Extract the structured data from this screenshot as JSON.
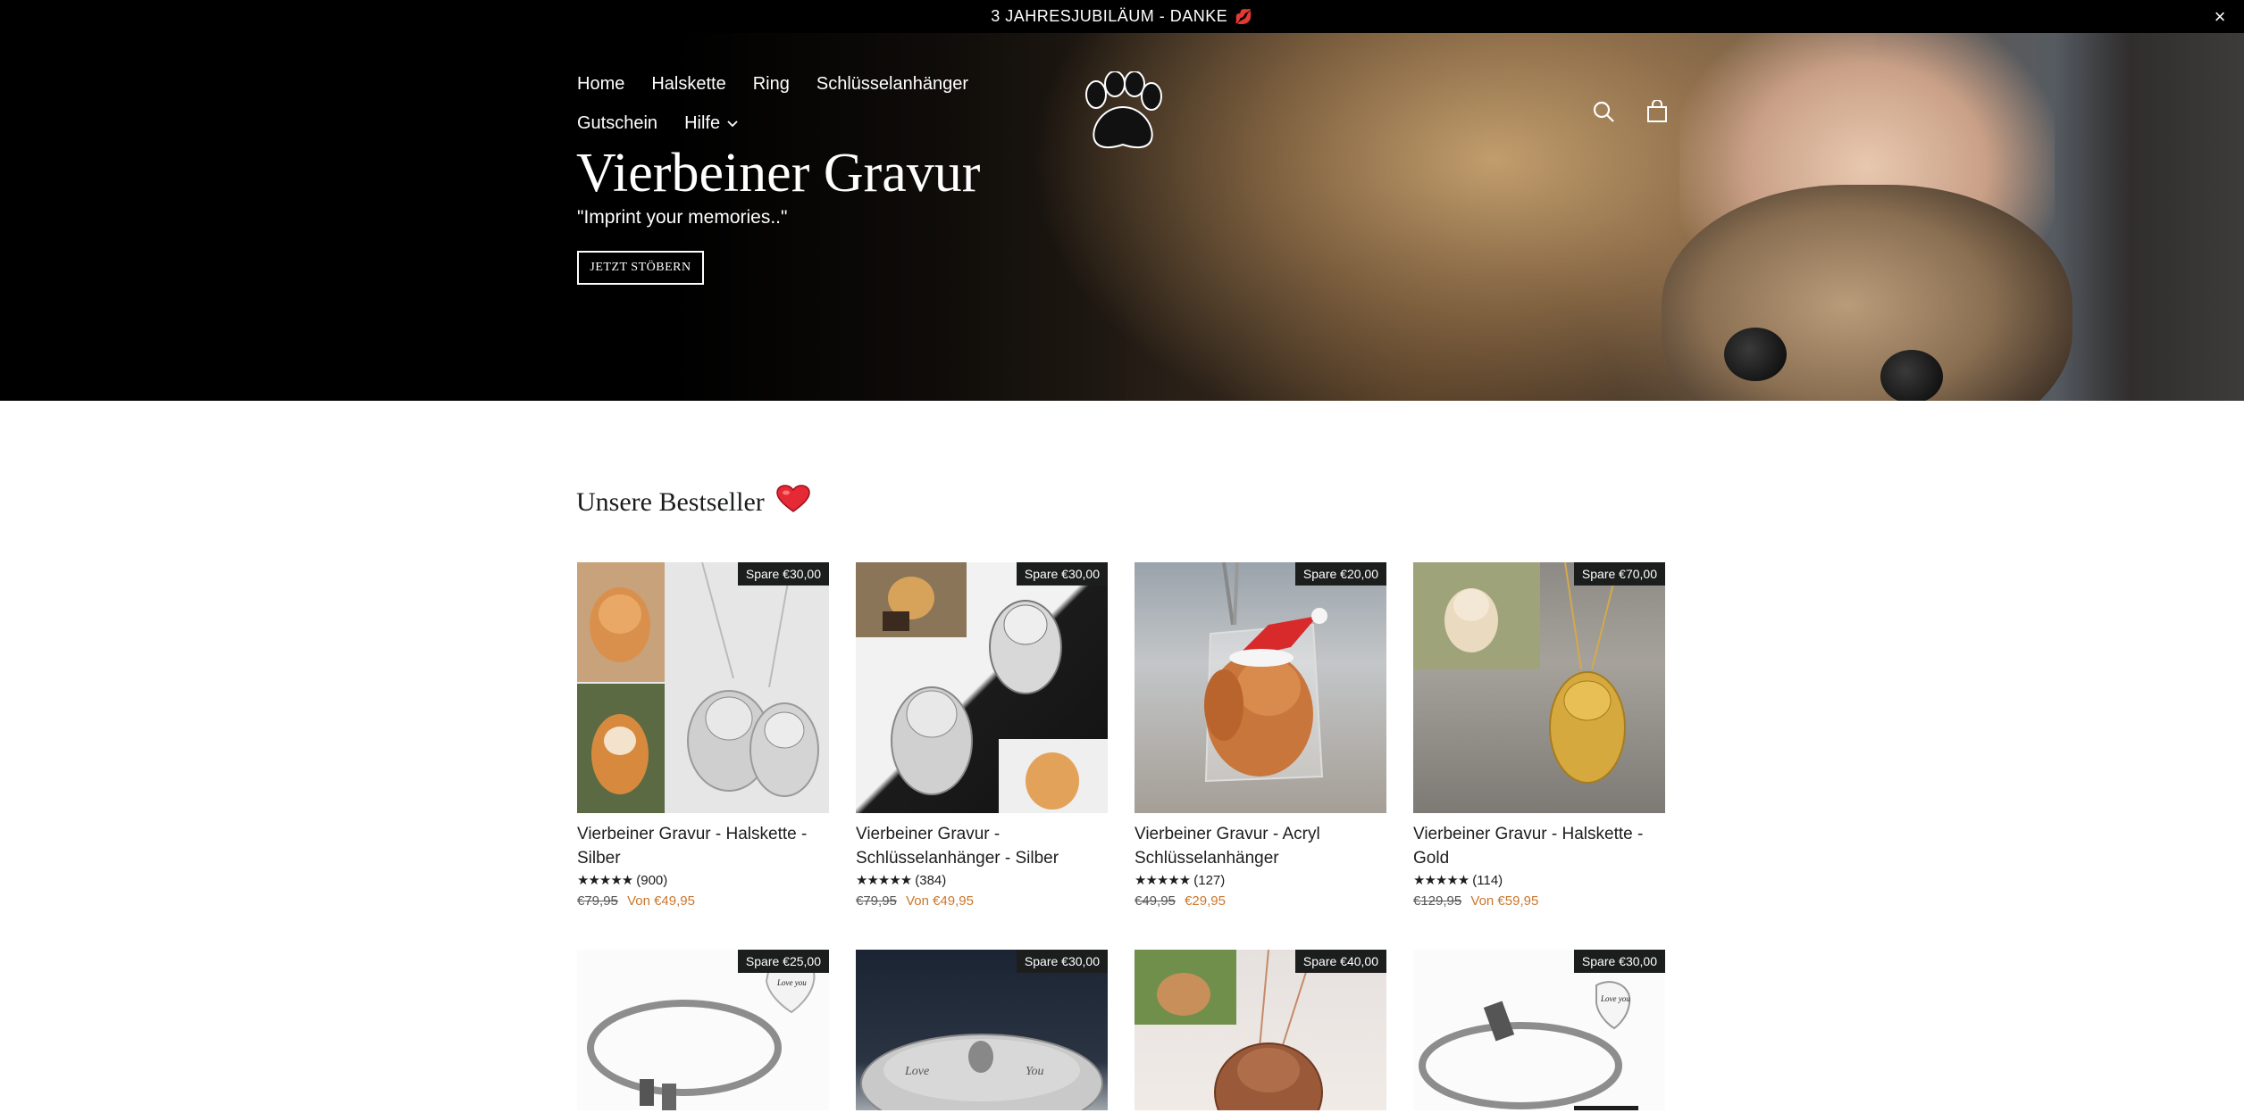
{
  "announcement": {
    "text": "3 JAHRESJUBILÄUM - DANKE",
    "emoji": "💋",
    "close_label": "×"
  },
  "nav": {
    "items": [
      {
        "label": "Home"
      },
      {
        "label": "Halskette"
      },
      {
        "label": "Ring"
      },
      {
        "label": "Schlüsselanhänger"
      },
      {
        "label": "Gutschein"
      }
    ],
    "dropdown": {
      "label": "Hilfe",
      "chevron": "⌄"
    }
  },
  "header_icons": {
    "search": "search-icon",
    "cart": "cart-icon",
    "logo": "paw-logo"
  },
  "hero": {
    "title": "Vierbeiner Gravur",
    "subtitle": "\"Imprint your memories..\"",
    "button_label": "JETZT STÖBERN"
  },
  "bestsellers": {
    "title": "Unsere Bestseller",
    "heart": "❤",
    "products": [
      {
        "badge": "Spare €30,00",
        "title": "Vierbeiner Gravur - Halskette - Silber",
        "rating": "★★★★★",
        "reviews": "(900)",
        "old_price": "€79,95",
        "price": "Von €49,95"
      },
      {
        "badge": "Spare €30,00",
        "title": "Vierbeiner Gravur - Schlüsselanhänger - Silber",
        "rating": "★★★★★",
        "reviews": "(384)",
        "old_price": "€79,95",
        "price": "Von €49,95"
      },
      {
        "badge": "Spare €20,00",
        "title": "Vierbeiner Gravur - Acryl Schlüsselanhänger",
        "rating": "★★★★★",
        "reviews": "(127)",
        "old_price": "€49,95",
        "price": "€29,95"
      },
      {
        "badge": "Spare €70,00",
        "title": "Vierbeiner Gravur - Halskette - Gold",
        "rating": "★★★★★",
        "reviews": "(114)",
        "old_price": "€129,95",
        "price": "Von €59,95"
      }
    ],
    "products_row2": [
      {
        "badge": "Spare €25,00"
      },
      {
        "badge": "Spare €30,00"
      },
      {
        "badge": "Spare €40,00"
      },
      {
        "badge": "Spare €30,00"
      }
    ]
  },
  "colors": {
    "accent_price": "#c9772d",
    "badge_bg": "#1c1d1d",
    "announcement_bg": "#000000"
  }
}
